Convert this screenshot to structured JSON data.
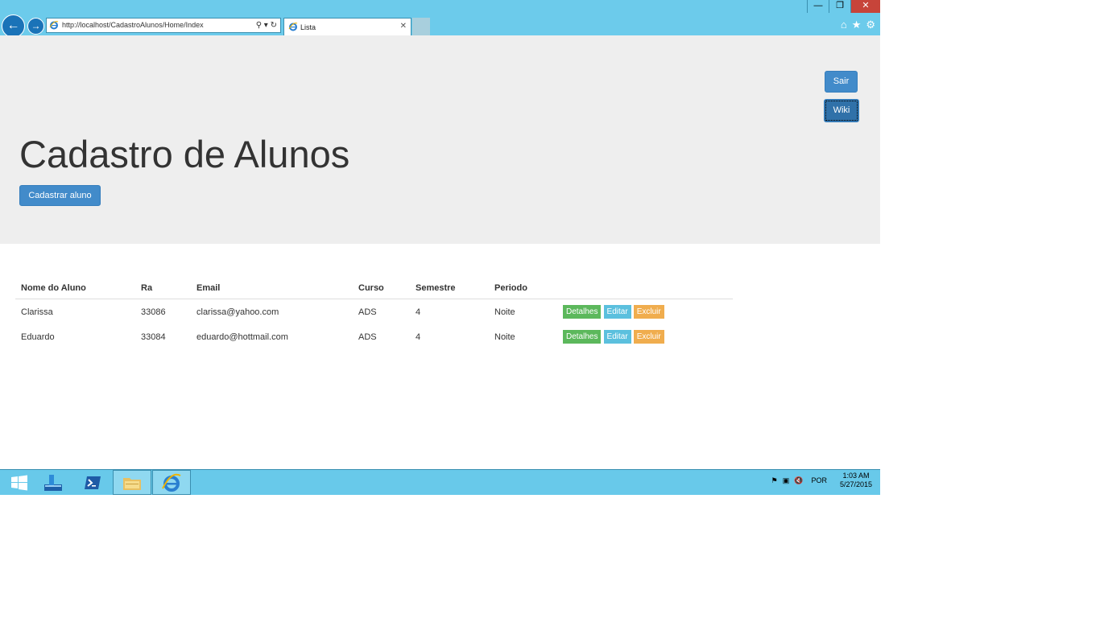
{
  "window": {
    "minimize_glyph": "—",
    "restore_glyph": "❐",
    "close_glyph": "✕"
  },
  "browser": {
    "address": "http://localhost/CadastroAlunos/Home/Index",
    "tab_title": "Lista",
    "icons": [
      "back-icon",
      "forward-icon",
      "ie-icon",
      "search-icon",
      "refresh-icon",
      "home-icon",
      "star-icon",
      "gear-icon"
    ]
  },
  "header": {
    "title": "Cadastro de Alunos",
    "add_button": "Cadastrar aluno",
    "logout_button": "Sair",
    "wiki_button": "Wiki"
  },
  "table": {
    "columns": [
      "Nome do Aluno",
      "Ra",
      "Email",
      "Curso",
      "Semestre",
      "Periodo"
    ],
    "rows": [
      {
        "nome": "Clarissa",
        "ra": "33086",
        "email": "clarissa@yahoo.com",
        "curso": "ADS",
        "semestre": "4",
        "periodo": "Noite"
      },
      {
        "nome": "Eduardo",
        "ra": "33084",
        "email": "eduardo@hottmail.com",
        "curso": "ADS",
        "semestre": "4",
        "periodo": "Noite"
      }
    ],
    "actions": {
      "details": "Detalhes",
      "edit": "Editar",
      "delete": "Excluir"
    }
  },
  "taskbar": {
    "language": "POR",
    "time": "1:03 AM",
    "date": "5/27/2015"
  },
  "colors": {
    "chrome": "#6ccbeb",
    "primary": "#428bca",
    "success": "#5cb85c",
    "info": "#5bc0de",
    "warning": "#f0ad4e",
    "jumbotron": "#eeeeee"
  }
}
